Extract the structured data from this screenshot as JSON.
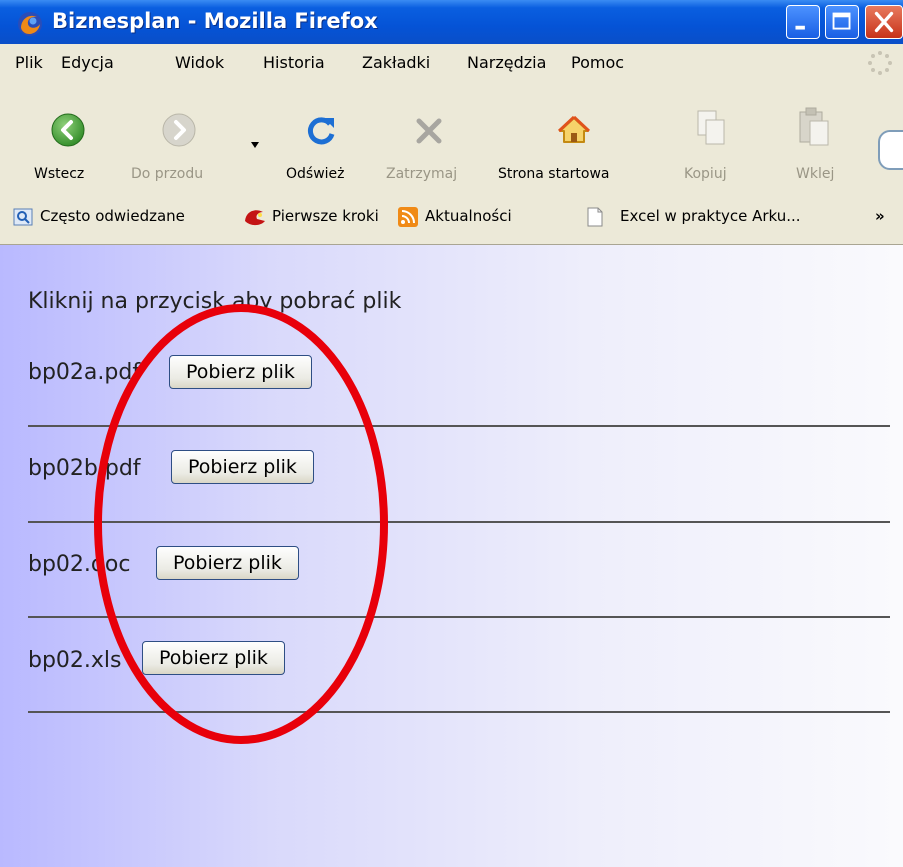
{
  "window": {
    "title": "Biznesplan - Mozilla Firefox"
  },
  "menu": [
    "Plik",
    "Edycja",
    "Widok",
    "Historia",
    "Zakładki",
    "Narzędzia",
    "Pomoc"
  ],
  "toolbar": {
    "back": "Wstecz",
    "forward": "Do przodu",
    "reload": "Odśwież",
    "stop": "Zatrzymaj",
    "home": "Strona startowa",
    "copy": "Kopiuj",
    "paste": "Wklej"
  },
  "bookmarks": {
    "most_visited": "Często odwiedzane",
    "getting_started": "Pierwsze kroki",
    "news": "Aktualności",
    "excel": "Excel w praktyce Arku...",
    "more": "»"
  },
  "page": {
    "intro": "Kliknij na przycisk aby pobrać plik",
    "files": [
      {
        "name": "bp02a.pdf",
        "button": "Pobierz plik"
      },
      {
        "name": "bp02b.pdf",
        "button": "Pobierz plik"
      },
      {
        "name": "bp02.doc",
        "button": "Pobierz plik"
      },
      {
        "name": "bp02.xls",
        "button": "Pobierz plik"
      }
    ]
  },
  "colors": {
    "titlebar": "#0553d6",
    "chrome": "#ece9d8",
    "annotation": "#e8000a"
  },
  "icons": [
    "firefox-icon",
    "minimize-icon",
    "maximize-icon",
    "close-icon",
    "back-arrow-icon",
    "forward-arrow-icon",
    "reload-icon",
    "stop-icon",
    "home-icon",
    "copy-icon",
    "paste-icon",
    "rss-icon",
    "page-icon",
    "bookmark-folder-icon",
    "firefox-red-icon"
  ]
}
